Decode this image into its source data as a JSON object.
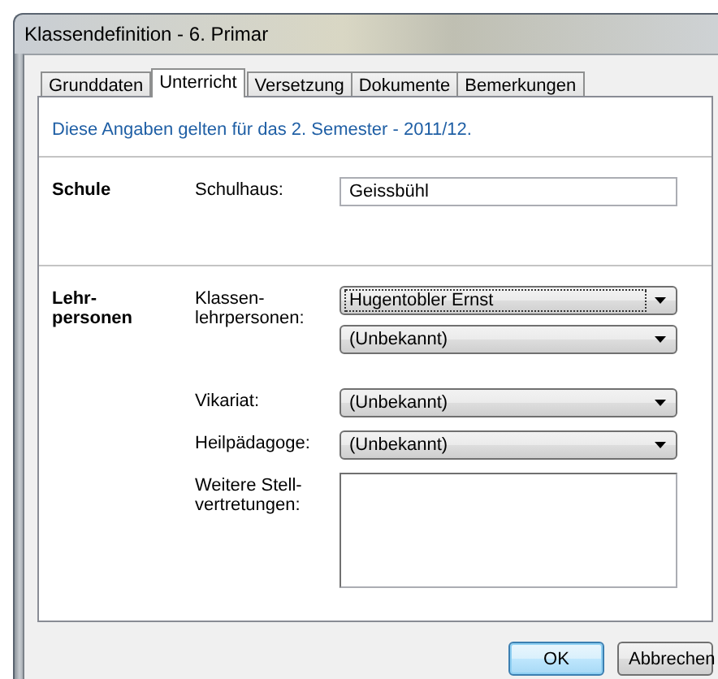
{
  "window": {
    "title": "Klassendefinition - 6. Primar"
  },
  "tabs": [
    {
      "label": "Grunddaten",
      "selected": false
    },
    {
      "label": "Unterricht",
      "selected": true
    },
    {
      "label": "Versetzung",
      "selected": false
    },
    {
      "label": "Dokumente",
      "selected": false
    },
    {
      "label": "Bemerkungen",
      "selected": false
    }
  ],
  "info_text": "Diese Angaben gelten für das 2. Semester - 2011/12.",
  "sections": [
    {
      "heading": "Schule",
      "rows": [
        {
          "label": "Schulhaus:",
          "fields": [
            {
              "kind": "text",
              "value": "Geissbühl"
            }
          ]
        }
      ]
    },
    {
      "heading": "Lehr-\npersonen",
      "rows": [
        {
          "label": "Klassen-\nlehrpersonen:",
          "fields": [
            {
              "kind": "combo",
              "value": "Hugentobler Ernst",
              "focused": true
            },
            {
              "kind": "combo",
              "value": "(Unbekannt)",
              "focused": false
            }
          ]
        },
        {
          "label": "Vikariat:",
          "fields": [
            {
              "kind": "combo",
              "value": "(Unbekannt)",
              "focused": false
            }
          ]
        },
        {
          "label": "Heilpädagoge:",
          "fields": [
            {
              "kind": "combo",
              "value": "(Unbekannt)",
              "focused": false
            }
          ]
        },
        {
          "label": "Weitere Stell-\nvertretungen:",
          "fields": [
            {
              "kind": "textarea"
            }
          ]
        }
      ]
    }
  ],
  "buttons": [
    {
      "label": "OK",
      "default": true
    },
    {
      "label": "Abbrechen",
      "default": false
    }
  ]
}
